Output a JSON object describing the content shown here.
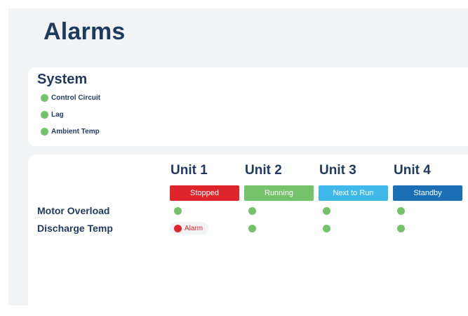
{
  "page": {
    "title": "Alarms"
  },
  "system": {
    "title": "System",
    "items": [
      {
        "label": "Control Circuit",
        "status": "ok"
      },
      {
        "label": "Lag",
        "status": "ok"
      },
      {
        "label": "Ambient Temp",
        "status": "ok"
      }
    ]
  },
  "units": [
    {
      "name": "Unit 1",
      "status": "Stopped",
      "status_color": "#e0242c"
    },
    {
      "name": "Unit 2",
      "status": "Running",
      "status_color": "#74c269"
    },
    {
      "name": "Unit 3",
      "status": "Next to Run",
      "status_color": "#3fb9ea"
    },
    {
      "name": "Unit 4",
      "status": "Standby",
      "status_color": "#1a6fb5"
    }
  ],
  "rows": [
    {
      "label": "Motor Overload",
      "cells": [
        "ok",
        "ok",
        "ok",
        "ok"
      ]
    },
    {
      "label": "Discharge Temp",
      "cells": [
        "alarm",
        "ok",
        "ok",
        "ok"
      ]
    }
  ],
  "alarm_label": "Alarm",
  "colors": {
    "ok": "#74c269",
    "alarm": "#e0242c",
    "title": "#1e3a5f",
    "background": "#f2f3f5"
  }
}
